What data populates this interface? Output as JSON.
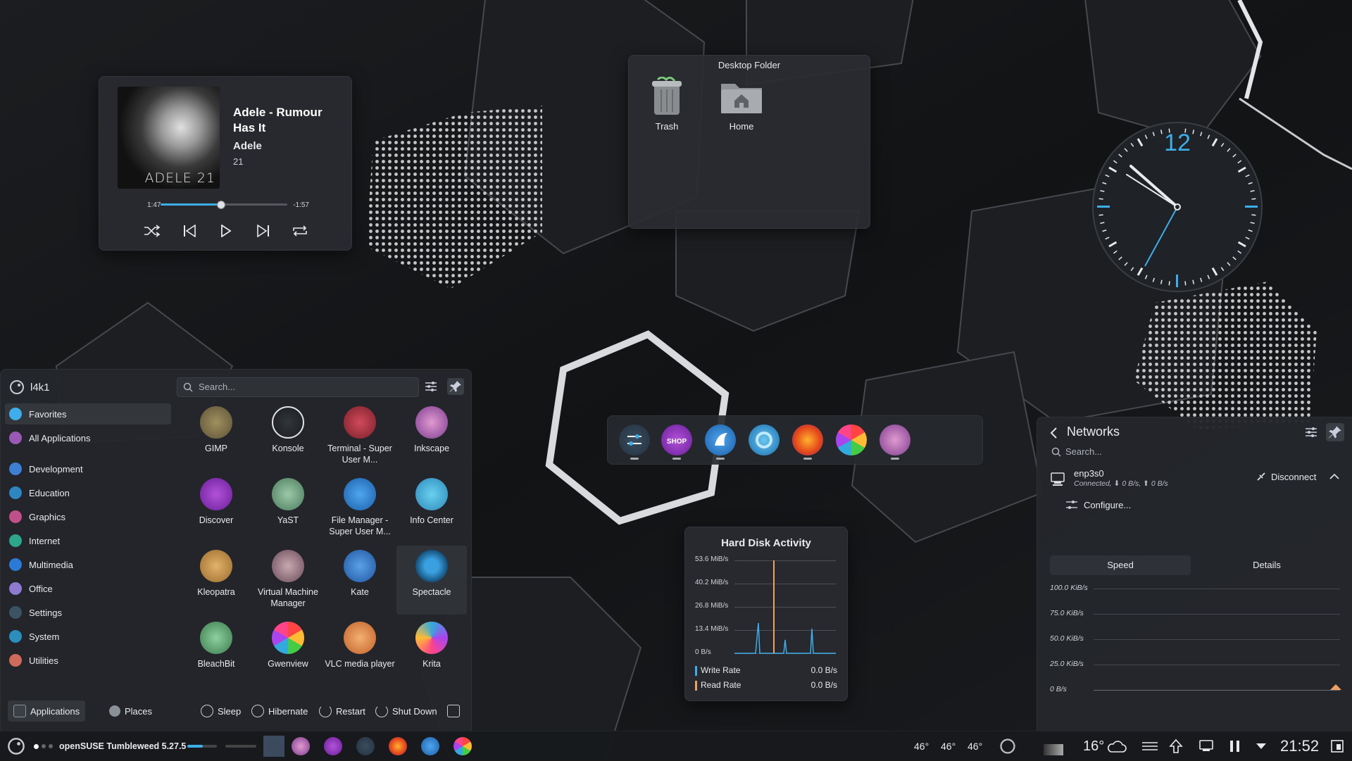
{
  "media": {
    "title": "Adele - Rumour Has It",
    "artist": "Adele",
    "album": "21",
    "cover_text": "ADELE 21",
    "elapsed": "1:47",
    "remaining": "-1:57",
    "progress": 0.47
  },
  "folder": {
    "title": "Desktop Folder",
    "items": [
      {
        "label": "Trash"
      },
      {
        "label": "Home"
      }
    ]
  },
  "clock": {
    "twelve": "12"
  },
  "disk": {
    "title": "Hard Disk Activity",
    "ticks": [
      "53.6 MiB/s",
      "40.2 MiB/s",
      "26.8 MiB/s",
      "13.4 MiB/s",
      "0 B/s"
    ],
    "write_label": "Write Rate",
    "write_value": "0.0 B/s",
    "read_label": "Read Rate",
    "read_value": "0.0 B/s",
    "write_color": "#3daee9",
    "read_color": "#f0a060"
  },
  "menu": {
    "user": "l4k1",
    "search_placeholder": "Search...",
    "categories": [
      "Favorites",
      "All Applications",
      "Development",
      "Education",
      "Graphics",
      "Internet",
      "Multimedia",
      "Office",
      "Settings",
      "System",
      "Utilities"
    ],
    "apps": [
      "GIMP",
      "Konsole",
      "Terminal - Super User M...",
      "Inkscape",
      "Discover",
      "YaST",
      "File Manager - Super User M...",
      "Info Center",
      "Kleopatra",
      "Virtual Machine Manager",
      "Kate",
      "Spectacle",
      "BleachBit",
      "Gwenview",
      "VLC media player",
      "Krita"
    ],
    "footer": {
      "applications": "Applications",
      "places": "Places",
      "sleep": "Sleep",
      "hibernate": "Hibernate",
      "restart": "Restart",
      "shutdown": "Shut Down"
    }
  },
  "network": {
    "title": "Networks",
    "search_placeholder": "Search...",
    "connection_name": "enp3s0",
    "connection_status": "Connected, ⬇ 0 B/s, ⬆ 0 B/s",
    "disconnect": "Disconnect",
    "configure": "Configure...",
    "tab_speed": "Speed",
    "tab_details": "Details",
    "ticks": [
      "100.0 KiB/s",
      "75.0 KiB/s",
      "50.0 KiB/s",
      "25.0 KiB/s",
      "0 B/s"
    ]
  },
  "taskbar": {
    "system_name": "openSUSE Tumbleweed 5.27.5",
    "temps": [
      "46°",
      "46°",
      "46°"
    ],
    "weather": "16°",
    "time": "21:52"
  }
}
